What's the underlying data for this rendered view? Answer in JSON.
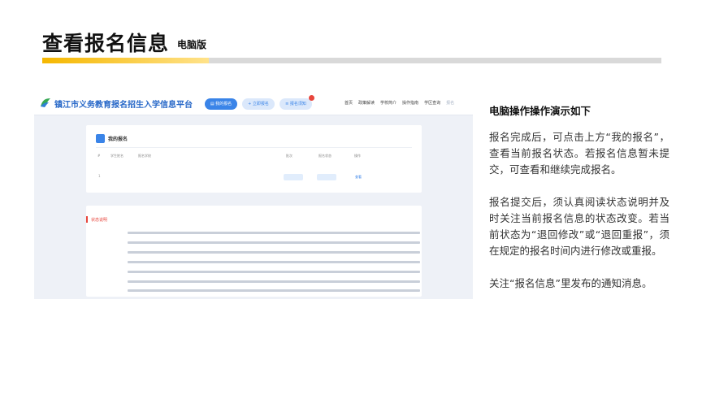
{
  "slide": {
    "title": "查看报名信息",
    "subtitle": "电脑版",
    "accent_color": "#f5b700"
  },
  "screenshot": {
    "site_name": "镇江市义务教育报名招生入学信息平台",
    "nav_buttons": [
      {
        "label": "我的报名",
        "icon": "doc-icon"
      },
      {
        "label": "立即报名",
        "icon": "plus-icon"
      },
      {
        "label": "报名须知",
        "icon": "list-icon"
      }
    ],
    "nav_links": [
      "首页",
      "政策解读",
      "学校简介",
      "操作指南",
      "学区查询"
    ],
    "nav_link_truncated": "报名",
    "my_registration": {
      "title": "我的报名",
      "headers": [
        "#",
        "学生姓名",
        "报名学校",
        "批次",
        "报名状态",
        "操作"
      ],
      "row": {
        "index": "1",
        "student": "",
        "school": "",
        "submit_time": "",
        "review_status": "",
        "batch_tag": "",
        "status_tag": "",
        "action": "查看"
      }
    },
    "status_notes": {
      "title": "状态说明",
      "labels": [
        "",
        "",
        "",
        "",
        "",
        "",
        ""
      ]
    }
  },
  "instructions": {
    "heading": "电脑操作操作演示如下",
    "paragraphs": [
      "报名完成后，可点击上方“我的报名”，查看当前报名状态。若报名信息暂未提交，可查看和继续完成报名。",
      "报名提交后，须认真阅读状态说明并及时关注当前报名信息的状态改变。若当前状态为“退回修改”或“退回重报”，须在规定的报名时间内进行修改或重报。",
      "关注“报名信息”里发布的通知消息。"
    ]
  }
}
